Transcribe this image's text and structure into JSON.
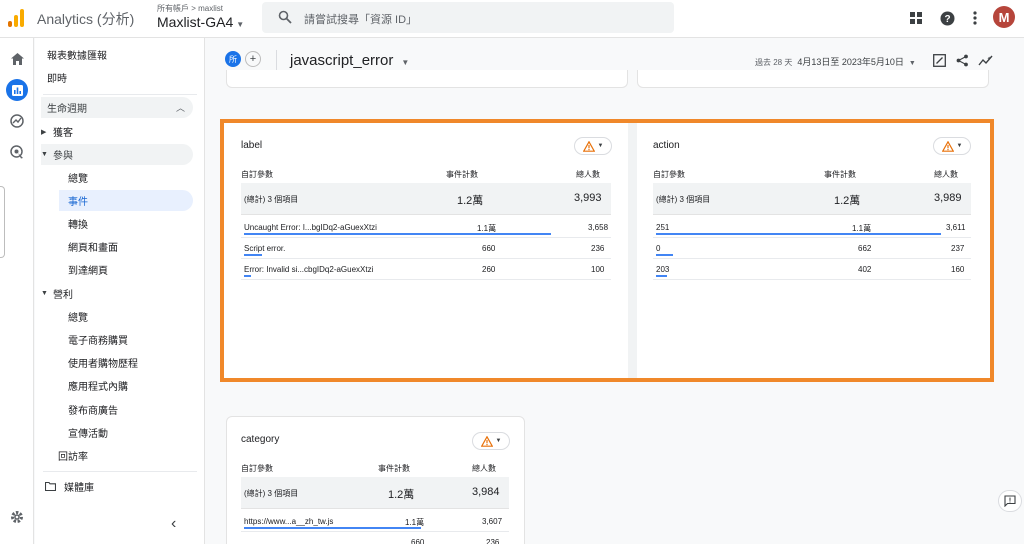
{
  "header": {
    "app_title": "Analytics (分析)",
    "account_path": "所有帳戶 > maxlist",
    "property_name": "Maxlist-GA4",
    "search_placeholder": "請嘗試搜尋「資源 ID」",
    "avatar_letter": "M"
  },
  "sidebar": {
    "section_title": "報表數據匯報",
    "realtime": "即時",
    "lifecycle": "生命週期",
    "acquisition": "獲客",
    "engagement": "參與",
    "eng_items": [
      "總覽",
      "事件",
      "轉換",
      "網頁和畫面",
      "到達網頁"
    ],
    "monetization": "營利",
    "mon_items": [
      "總覽",
      "電子商務購買",
      "使用者購物歷程",
      "應用程式內購",
      "發布商廣告",
      "宣傳活動"
    ],
    "retention": "回訪率",
    "library": "媒體庫"
  },
  "report": {
    "chip_label": "所",
    "add_label": "+",
    "title": "javascript_error",
    "date_label": "過去 28 天",
    "date_range": "4月13日至 2023年5月10日"
  },
  "cards": {
    "label": {
      "title": "label",
      "col_param": "自訂參數",
      "col_events": "事件計數",
      "col_users": "總人數",
      "total_label": "(總計) 3 個項目",
      "total_events": "1.2萬",
      "total_users": "3,993",
      "rows": [
        {
          "name": "Uncaught Error: I...bgIDq2-aGuexXtzi",
          "events": "1.1萬",
          "users": "3,658",
          "share": 0.92
        },
        {
          "name": "Script error.",
          "events": "660",
          "users": "236",
          "share": 0.055
        },
        {
          "name": "Error: Invalid si...cbgIDq2-aGuexXtzi",
          "events": "260",
          "users": "100",
          "share": 0.022
        }
      ]
    },
    "action": {
      "title": "action",
      "col_param": "自訂參數",
      "col_events": "事件計數",
      "col_users": "總人數",
      "total_label": "(總計) 3 個項目",
      "total_events": "1.2萬",
      "total_users": "3,989",
      "rows": [
        {
          "name": "251",
          "events": "1.1萬",
          "users": "3,611",
          "share": 0.92
        },
        {
          "name": "0",
          "events": "662",
          "users": "237",
          "share": 0.055
        },
        {
          "name": "203",
          "events": "402",
          "users": "160",
          "share": 0.034
        }
      ]
    },
    "category": {
      "title": "category",
      "col_param": "自訂參數",
      "col_events": "事件計數",
      "col_users": "總人數",
      "total_label": "(總計) 3 個項目",
      "total_events": "1.2萬",
      "total_users": "3,984",
      "rows": [
        {
          "name": "https://www...a__zh_tw.js",
          "events": "1.1萬",
          "users": "3,607",
          "share": 0.92
        },
        {
          "name": "",
          "events": "660",
          "users": "236",
          "share": 0.055
        }
      ]
    }
  },
  "colors": {
    "accent_blue": "#1a73e8",
    "highlight_orange": "#f0882a",
    "warning_orange": "#e8710a",
    "bar_blue": "#4285f4"
  },
  "icons": [
    "search-icon",
    "apps-grid-icon",
    "help-icon",
    "more-vert-icon",
    "home-icon",
    "reports-icon",
    "explore-icon",
    "advertising-icon",
    "settings-icon",
    "folder-icon",
    "warning-icon",
    "share-icon",
    "insights-icon",
    "customize-report-icon",
    "feedback-icon"
  ]
}
